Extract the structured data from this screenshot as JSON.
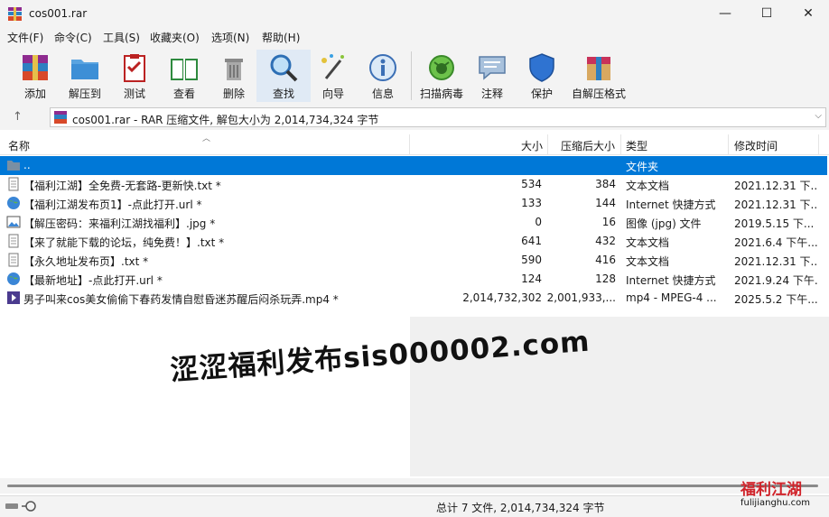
{
  "window": {
    "title": "cos001.rar",
    "minimize_glyph": "—",
    "maximize_glyph": "☐",
    "close_glyph": "✕"
  },
  "menu": [
    "文件(F)",
    "命令(C)",
    "工具(S)",
    "收藏夹(O)",
    "选项(N)",
    "帮助(H)"
  ],
  "toolbar": [
    {
      "label": "添加",
      "icon": "add-archive-icon"
    },
    {
      "label": "解压到",
      "icon": "extract-folder-icon"
    },
    {
      "label": "测试",
      "icon": "test-clipboard-icon"
    },
    {
      "label": "查看",
      "icon": "view-book-icon"
    },
    {
      "label": "删除",
      "icon": "trash-can-icon"
    },
    {
      "label": "查找",
      "icon": "magnifier-icon"
    },
    {
      "label": "向导",
      "icon": "wizard-wand-icon"
    },
    {
      "label": "信息",
      "icon": "info-icon"
    },
    {
      "label": "扫描病毒",
      "icon": "virus-scan-icon"
    },
    {
      "label": "注释",
      "icon": "comment-icon"
    },
    {
      "label": "保护",
      "icon": "shield-icon"
    },
    {
      "label": "自解压格式",
      "icon": "sfx-box-icon"
    }
  ],
  "address": {
    "up_glyph": "↑",
    "text": "cos001.rar - RAR 压缩文件, 解包大小为 2,014,734,324 字节",
    "chevron": "⌵"
  },
  "columns": {
    "name": "名称",
    "size": "大小",
    "packed": "压缩后大小",
    "type": "类型",
    "modified": "修改时间"
  },
  "files": [
    {
      "name": "..",
      "size": "",
      "packed": "",
      "type": "文件夹",
      "modified": "",
      "icon": "folder-icon",
      "selected": true
    },
    {
      "name": "【福利江湖】全免费-无套路-更新快.txt *",
      "size": "534",
      "packed": "384",
      "type": "文本文档",
      "modified": "2021.12.31 下...",
      "icon": "text-file-icon",
      "selected": false
    },
    {
      "name": "【福利江湖发布页1】-点此打开.url *",
      "size": "133",
      "packed": "144",
      "type": "Internet 快捷方式",
      "modified": "2021.12.31 下...",
      "icon": "internet-shortcut-icon",
      "selected": false
    },
    {
      "name": "【解压密码：来福利江湖找福利】.jpg *",
      "size": "0",
      "packed": "16",
      "type": "图像 (jpg) 文件",
      "modified": "2019.5.15 下...",
      "icon": "image-file-icon",
      "selected": false
    },
    {
      "name": "【来了就能下载的论坛，纯免费！】.txt *",
      "size": "641",
      "packed": "432",
      "type": "文本文档",
      "modified": "2021.6.4 下午...",
      "icon": "text-file-icon",
      "selected": false
    },
    {
      "name": "【永久地址发布页】.txt *",
      "size": "590",
      "packed": "416",
      "type": "文本文档",
      "modified": "2021.12.31 下...",
      "icon": "text-file-icon",
      "selected": false
    },
    {
      "name": "【最新地址】-点此打开.url *",
      "size": "124",
      "packed": "128",
      "type": "Internet 快捷方式",
      "modified": "2021.9.24 下午...",
      "icon": "internet-shortcut-icon",
      "selected": false
    },
    {
      "name": "男子叫来cos美女偷偷下春药发情自慰昏迷苏醒后闷杀玩弄.mp4 *",
      "size": "2,014,732,302",
      "packed": "2,001,933,...",
      "type": "mp4 - MPEG-4 ...",
      "modified": "2025.5.2 下午...",
      "icon": "video-file-icon",
      "selected": false
    }
  ],
  "status": {
    "text": "总计 7 文件, 2,014,734,324 字节"
  },
  "watermark": {
    "text": "涩涩福利发布sis000002.com"
  },
  "logo": {
    "cn": "福利江湖",
    "en": "fulijianghu.com"
  },
  "colors": {
    "selection": "#0078d7",
    "chrome": "#f3f3f3",
    "logo_red": "#d0232a"
  }
}
